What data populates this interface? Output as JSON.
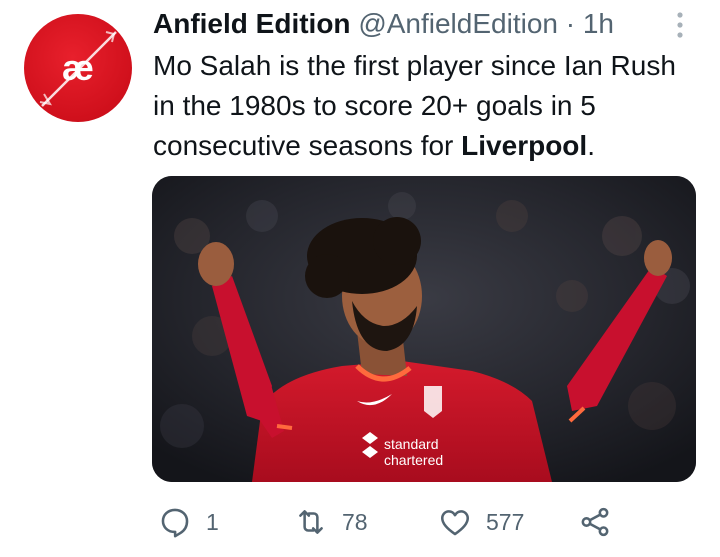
{
  "tweet": {
    "author": {
      "display_name": "Anfield Edition",
      "handle": "@AnfieldEdition",
      "avatar_initials": "æ"
    },
    "separator": "·",
    "timestamp": "1h",
    "text": {
      "before_bold": "Mo Salah is the first player since Ian Rush in the 1980s to score 20+ goals in 5 consecutive seasons for ",
      "bold": "Liverpool",
      "after_bold": "."
    },
    "media": {
      "sponsor_line1": "standard",
      "sponsor_line2": "chartered"
    },
    "actions": {
      "reply_count": "1",
      "retweet_count": "78",
      "like_count": "577"
    }
  },
  "colors": {
    "text_primary": "#0f1419",
    "text_secondary": "#536471",
    "avatar_red": "#d0101c",
    "kit_red": "#c8102e"
  },
  "icons": [
    "more-icon",
    "reply-icon",
    "retweet-icon",
    "like-icon",
    "share-icon"
  ]
}
